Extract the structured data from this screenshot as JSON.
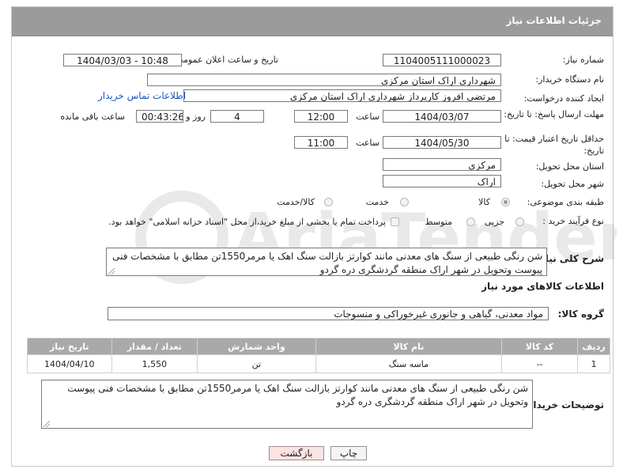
{
  "header": {
    "title": "جزئیات اطلاعات نیاز"
  },
  "fields": {
    "need_number_label": "شماره نیاز:",
    "need_number": "1104005111000023",
    "announce_label": "تاریخ و ساعت اعلان عمومی:",
    "announce_value": "1404/03/03 - 10:48",
    "buyer_org_label": "نام دستگاه خریدار:",
    "buyer_org": "شهرداری اراک استان مرکزی",
    "creator_label": "ایجاد کننده درخواست:",
    "creator": "مرتضی افروز کارپرداز شهرداری اراک استان مرکزی",
    "contact_link": "اطلاعات تماس خریدار",
    "deadline_label": "مهلت ارسال پاسخ: تا تاریخ:",
    "deadline_date": "1404/03/07",
    "time_label": "ساعت",
    "deadline_time": "12:00",
    "days_value": "4",
    "days_label": "روز و",
    "remaining_time": "00:43:26",
    "remaining_label": "ساعت باقی مانده",
    "min_price_label": "حداقل تاریخ اعتبار قیمت: تا تاریخ:",
    "min_price_date": "1404/05/30",
    "min_price_time": "11:00",
    "province_label": "استان محل تحویل:",
    "province": "مرکزی",
    "city_label": "شهر محل تحویل:",
    "city": "اراک",
    "category_label": "طبقه بندی موضوعی:",
    "category_options": [
      "کالا",
      "خدمت",
      "کالا/خدمت"
    ],
    "process_label": "نوع فرآیند خرید :",
    "process_options": [
      "جزیی",
      "متوسط"
    ],
    "payment_note": "پرداخت تمام یا بخشی از مبلغ خرید،از محل \"اسناد خزانه اسلامی\" خواهد بود."
  },
  "description": {
    "label": "شرح کلی نیاز:",
    "text": "شن رنگی طبیعی از سنگ های معدنی مانند کوارتز بازالت سنگ اهک یا مرمر1550تن مطابق با مشخصات فنی پیوست وتحویل در شهر اراک منطقه گردشگری دره گردو"
  },
  "goods": {
    "section_title": "اطلاعات کالاهای مورد نیاز",
    "group_label": "گروه کالا:",
    "group_value": "مواد معدنی، گیاهی و جانوری غیرخوراکی و منسوجات",
    "columns": [
      "ردیف",
      "کد کالا",
      "نام کالا",
      "واحد شمارش",
      "تعداد / مقدار",
      "تاریخ نیاز"
    ],
    "rows": [
      {
        "row": "1",
        "code": "--",
        "name": "ماسه سنگ",
        "unit": "تن",
        "qty": "1,550",
        "date": "1404/04/10"
      }
    ]
  },
  "buyer_notes": {
    "label": "توضیحات خریدار:",
    "text": "شن رنگی طبیعی از سنگ های معدنی مانند کوارتز بازالت سنگ اهک یا مرمر1550تن مطابق با مشخصات فنی پیوست وتحویل در شهر اراک منطقه گردشگری دره گردو"
  },
  "buttons": {
    "print": "چاپ",
    "back": "بازگشت"
  },
  "watermark": {
    "text": "AriaTender.neT"
  }
}
